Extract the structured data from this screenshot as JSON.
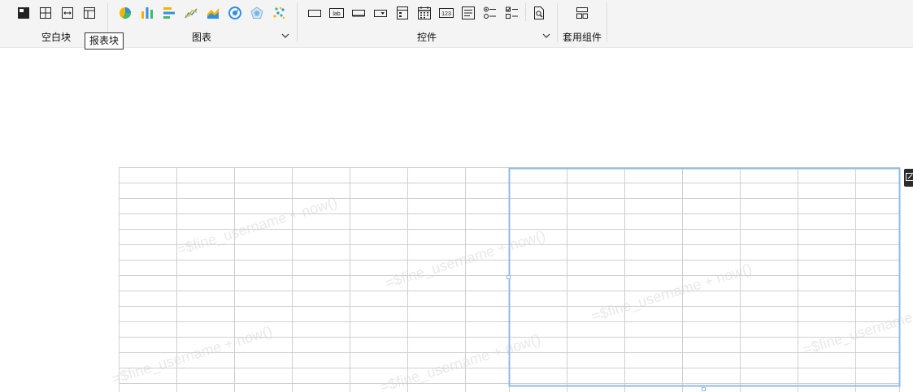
{
  "toolbar": {
    "groups": [
      {
        "label": "空白块",
        "icons": [
          "absolute-layout-icon",
          "grid-layout-icon",
          "horizontal-split-icon",
          "tab-layout-icon"
        ],
        "has_dropdown": false
      },
      {
        "label": "图表",
        "icons": [
          "pie-chart-icon",
          "bar-chart-icon",
          "horizontal-bar-chart-icon",
          "line-chart-icon",
          "area-chart-icon",
          "gauge-chart-icon",
          "radar-chart-icon",
          "scatter-chart-icon"
        ],
        "has_dropdown": true
      },
      {
        "label": "控件",
        "icons": [
          "text-field-icon",
          "label-icon",
          "button-icon",
          "dropdown-icon",
          "dropdown-tree-icon",
          "date-picker-icon",
          "number-field-icon",
          "text-area-icon",
          "radio-group-icon",
          "checkbox-group-icon",
          "query-button-icon"
        ],
        "has_dropdown": true
      },
      {
        "label": "套用组件",
        "icons": [
          "template-component-icon"
        ],
        "has_dropdown": false
      }
    ],
    "tooltip": "报表块",
    "label_icon_text": "lab",
    "number_icon_text": "123"
  },
  "canvas": {
    "watermark_text": "=$fine_username + now()",
    "selection_color": "#8fbbe6",
    "grid_color": "#cfcfcf",
    "watermark_color": "#e9e9e9"
  }
}
